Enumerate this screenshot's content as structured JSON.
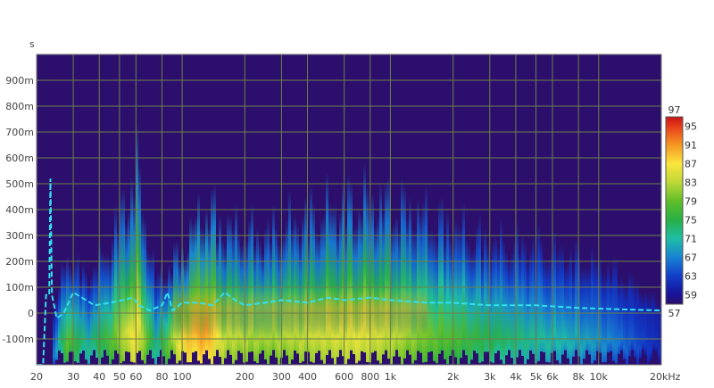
{
  "chart_data": {
    "type": "heatmap",
    "title": "",
    "xlabel": "",
    "ylabel": "s",
    "x_scale": "log",
    "x_unit": "kHz",
    "x_range_hz": [
      20,
      20000
    ],
    "y_range_s": [
      -0.2,
      1.0
    ],
    "x_ticks": [
      {
        "hz": 20,
        "label": "20"
      },
      {
        "hz": 30,
        "label": "30"
      },
      {
        "hz": 40,
        "label": "40"
      },
      {
        "hz": 50,
        "label": "50"
      },
      {
        "hz": 60,
        "label": "60"
      },
      {
        "hz": 80,
        "label": "80"
      },
      {
        "hz": 100,
        "label": "100"
      },
      {
        "hz": 200,
        "label": "200"
      },
      {
        "hz": 300,
        "label": "300"
      },
      {
        "hz": 400,
        "label": "400"
      },
      {
        "hz": 600,
        "label": "600"
      },
      {
        "hz": 800,
        "label": "800"
      },
      {
        "hz": 1000,
        "label": "1k"
      },
      {
        "hz": 2000,
        "label": "2k"
      },
      {
        "hz": 3000,
        "label": "3k"
      },
      {
        "hz": 4000,
        "label": "4k"
      },
      {
        "hz": 5000,
        "label": "5k"
      },
      {
        "hz": 6000,
        "label": "6k"
      },
      {
        "hz": 8000,
        "label": "8k"
      },
      {
        "hz": 10000,
        "label": "10k"
      },
      {
        "hz": 20000,
        "label": "20kHz"
      }
    ],
    "y_ticks": [
      {
        "s": 0.9,
        "label": "900m"
      },
      {
        "s": 0.8,
        "label": "800m"
      },
      {
        "s": 0.7,
        "label": "700m"
      },
      {
        "s": 0.6,
        "label": "600m"
      },
      {
        "s": 0.5,
        "label": "500m"
      },
      {
        "s": 0.4,
        "label": "400m"
      },
      {
        "s": 0.3,
        "label": "300m"
      },
      {
        "s": 0.2,
        "label": "200m"
      },
      {
        "s": 0.1,
        "label": "100m"
      },
      {
        "s": 0.0,
        "label": "0"
      },
      {
        "s": -0.1,
        "label": "-100m"
      }
    ],
    "colorbar": {
      "range": [
        57,
        97
      ],
      "labels": [
        "97",
        "95",
        "91",
        "87",
        "83",
        "79",
        "75",
        "71",
        "67",
        "63",
        "59",
        "57"
      ]
    },
    "spectrogram_envelope": [
      {
        "hz": 24,
        "top_s": 0.0,
        "peak_level": 66
      },
      {
        "hz": 28,
        "top_s": 0.31,
        "peak_level": 79
      },
      {
        "hz": 35,
        "top_s": 0.2,
        "peak_level": 72
      },
      {
        "hz": 45,
        "top_s": 0.36,
        "peak_level": 78
      },
      {
        "hz": 60,
        "top_s": 0.78,
        "peak_level": 88
      },
      {
        "hz": 75,
        "top_s": 0.18,
        "peak_level": 72
      },
      {
        "hz": 100,
        "top_s": 0.34,
        "peak_level": 88
      },
      {
        "hz": 130,
        "top_s": 0.58,
        "peak_level": 91
      },
      {
        "hz": 160,
        "top_s": 0.46,
        "peak_level": 84
      },
      {
        "hz": 250,
        "top_s": 0.42,
        "peak_level": 82
      },
      {
        "hz": 400,
        "top_s": 0.52,
        "peak_level": 84
      },
      {
        "hz": 700,
        "top_s": 0.6,
        "peak_level": 86
      },
      {
        "hz": 1000,
        "top_s": 0.58,
        "peak_level": 84
      },
      {
        "hz": 1500,
        "top_s": 0.52,
        "peak_level": 80
      },
      {
        "hz": 2000,
        "top_s": 0.46,
        "peak_level": 78
      },
      {
        "hz": 3000,
        "top_s": 0.38,
        "peak_level": 75
      },
      {
        "hz": 5000,
        "top_s": 0.36,
        "peak_level": 72
      },
      {
        "hz": 8000,
        "top_s": 0.3,
        "peak_level": 70
      },
      {
        "hz": 12000,
        "top_s": 0.24,
        "peak_level": 67
      },
      {
        "hz": 20000,
        "top_s": 0.06,
        "peak_level": 61
      }
    ],
    "series": [
      {
        "type": "line",
        "style": "dashed",
        "color": "#33dff0",
        "points": [
          [
            20,
            -0.2
          ],
          [
            21.5,
            -0.2
          ],
          [
            22.2,
            0.07
          ],
          [
            23,
            0.07
          ],
          [
            23.3,
            0.52
          ],
          [
            23.7,
            0.07
          ],
          [
            25,
            -0.02
          ],
          [
            27,
            0.0
          ],
          [
            30,
            0.08
          ],
          [
            33,
            0.06
          ],
          [
            38,
            0.03
          ],
          [
            45,
            0.04
          ],
          [
            52,
            0.05
          ],
          [
            58,
            0.06
          ],
          [
            62,
            0.03
          ],
          [
            70,
            0.01
          ],
          [
            80,
            0.03
          ],
          [
            85,
            0.08
          ],
          [
            90,
            0.01
          ],
          [
            100,
            0.04
          ],
          [
            120,
            0.04
          ],
          [
            140,
            0.03
          ],
          [
            160,
            0.08
          ],
          [
            180,
            0.05
          ],
          [
            200,
            0.03
          ],
          [
            250,
            0.04
          ],
          [
            300,
            0.05
          ],
          [
            400,
            0.04
          ],
          [
            500,
            0.06
          ],
          [
            600,
            0.05
          ],
          [
            800,
            0.06
          ],
          [
            1000,
            0.05
          ],
          [
            1500,
            0.04
          ],
          [
            2000,
            0.04
          ],
          [
            3000,
            0.03
          ],
          [
            5000,
            0.03
          ],
          [
            8000,
            0.02
          ],
          [
            12000,
            0.015
          ],
          [
            20000,
            0.01
          ]
        ]
      }
    ],
    "colors": {
      "background": "#2c0f6c",
      "grid": "#6e7f4a",
      "line": "#33dff0"
    }
  }
}
